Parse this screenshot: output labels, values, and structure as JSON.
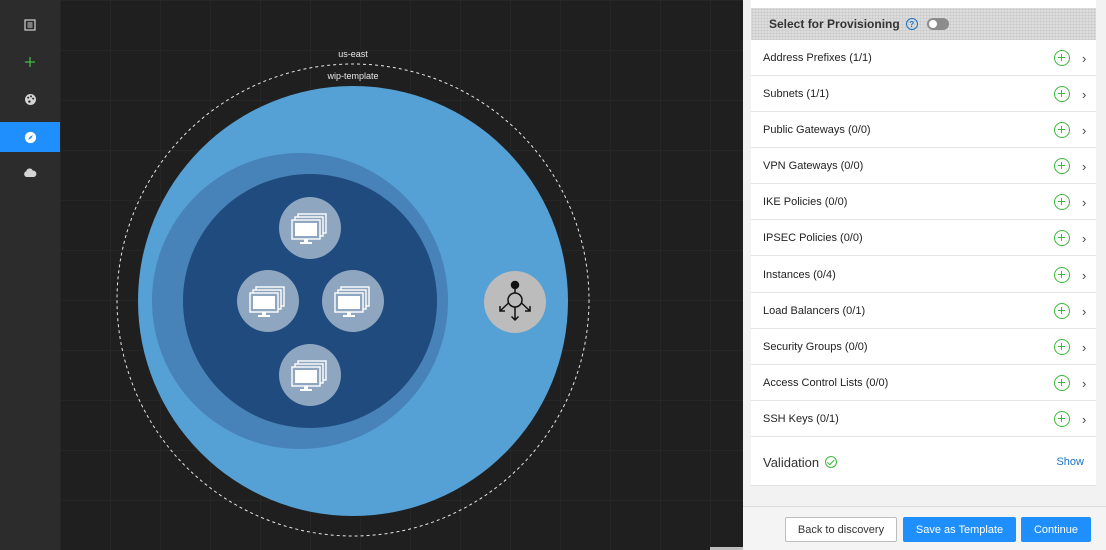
{
  "nav": {
    "items": [
      {
        "name": "list-icon",
        "active": false
      },
      {
        "name": "plus-icon",
        "active": false
      },
      {
        "name": "palette-icon",
        "active": false
      },
      {
        "name": "compass-icon",
        "active": true
      },
      {
        "name": "cloud-icon",
        "active": false
      }
    ]
  },
  "canvas": {
    "region_label": "us-east",
    "template_label": "wip-template",
    "colors": {
      "vpc": "#55a0d4",
      "subnet_ring": "#4782b8",
      "subnet": "#1f4b7e",
      "instance": "#8ea6bf",
      "load_balancer": "#bcbcbc"
    },
    "instances": [
      "monitor-icon",
      "monitor-icon",
      "monitor-icon",
      "monitor-icon"
    ],
    "load_balancer_icon": "load-balancer-icon"
  },
  "panel": {
    "provision_title": "Select for Provisioning",
    "provision_toggle_on": false,
    "resources": [
      {
        "label": "Address Prefixes  (1/1)"
      },
      {
        "label": "Subnets  (1/1)"
      },
      {
        "label": "Public Gateways  (0/0)"
      },
      {
        "label": "VPN Gateways  (0/0)"
      },
      {
        "label": "IKE Policies  (0/0)"
      },
      {
        "label": "IPSEC Policies  (0/0)"
      },
      {
        "label": "Instances  (0/4)"
      },
      {
        "label": "Load Balancers  (0/1)"
      },
      {
        "label": "Security Groups  (0/0)"
      },
      {
        "label": "Access Control Lists  (0/0)"
      },
      {
        "label": "SSH Keys  (0/1)"
      }
    ],
    "validation_label": "Validation",
    "show_label": "Show"
  },
  "footer": {
    "back_label": "Back to discovery",
    "save_label": "Save as Template",
    "continue_label": "Continue"
  }
}
